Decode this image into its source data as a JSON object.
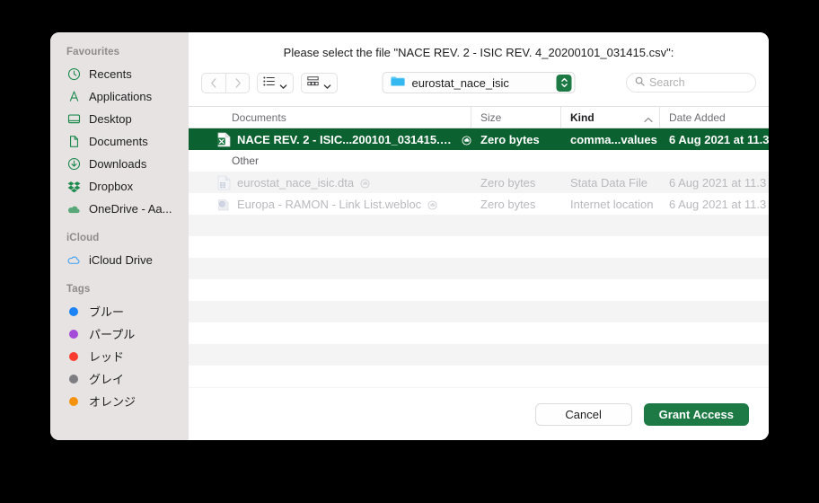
{
  "dialog": {
    "title": "Please select the file \"NACE REV. 2 - ISIC REV. 4_20200101_031415.csv\":"
  },
  "toolbar": {
    "back_icon": "chevron-left-icon",
    "forward_icon": "chevron-right-icon",
    "view_mode_icon": "list-view-icon",
    "group_mode_icon": "grid-view-icon",
    "path": {
      "folder_name": "eurostat_nace_isic",
      "folder_icon": "folder-icon",
      "stepper_icon": "updown-chevron-icon"
    },
    "search": {
      "placeholder": "Search",
      "value": "",
      "icon": "search-icon"
    }
  },
  "columns": {
    "name": "Documents",
    "size": "Size",
    "kind": "Kind",
    "date": "Date Added",
    "sorted_by": "Kind",
    "sort_direction": "ascending"
  },
  "files": [
    {
      "name": "NACE REV. 2 - ISIC...200101_031415.csv",
      "size": "Zero bytes",
      "kind": "comma...values",
      "date": "6 Aug 2021 at 11.3",
      "icon": "csv-file-icon",
      "badge": "cloud-download-icon",
      "selected": true,
      "disabled": false
    }
  ],
  "other_group": {
    "label": "Other",
    "files": [
      {
        "name": "eurostat_nace_isic.dta",
        "size": "Zero bytes",
        "kind": "Stata Data File",
        "date": "6 Aug 2021 at 11.3",
        "icon": "stata-file-icon",
        "badge": "cloud-download-icon",
        "selected": false,
        "disabled": true
      },
      {
        "name": "Europa - RAMON - Link List.webloc",
        "size": "Zero bytes",
        "kind": "Internet location",
        "date": "6 Aug 2021 at 11.3",
        "icon": "webloc-file-icon",
        "badge": "cloud-download-icon",
        "selected": false,
        "disabled": true
      }
    ]
  },
  "sidebar": {
    "groups": [
      {
        "title": "Favourites",
        "items": [
          {
            "label": "Recents",
            "icon": "clock-icon"
          },
          {
            "label": "Applications",
            "icon": "applications-icon"
          },
          {
            "label": "Desktop",
            "icon": "desktop-icon"
          },
          {
            "label": "Documents",
            "icon": "document-icon"
          },
          {
            "label": "Downloads",
            "icon": "download-icon"
          },
          {
            "label": "Dropbox",
            "icon": "dropbox-icon"
          },
          {
            "label": "OneDrive - Aa...",
            "icon": "onedrive-icon"
          }
        ]
      },
      {
        "title": "iCloud",
        "items": [
          {
            "label": "iCloud Drive",
            "icon": "icloud-icon"
          }
        ]
      },
      {
        "title": "Tags",
        "items": [
          {
            "label": "ブルー",
            "icon": "tag-dot-icon",
            "color": "#1a83f7"
          },
          {
            "label": "パープル",
            "icon": "tag-dot-icon",
            "color": "#a councillor"
          },
          {
            "label": "レッド",
            "icon": "tag-dot-icon",
            "color": "#fc3b30"
          },
          {
            "label": "グレイ",
            "icon": "tag-dot-icon",
            "color": "#7d7d82"
          },
          {
            "label": "オレンジ",
            "icon": "tag-dot-icon",
            "color": "#f5920b"
          }
        ]
      }
    ]
  },
  "buttons": {
    "cancel": "Cancel",
    "grant": "Grant Access"
  },
  "colors": {
    "accent": "#1d7a45",
    "selection": "#0c6130",
    "sidebar_bg": "#e7e3e2",
    "stripe": "#f4f4f5"
  }
}
